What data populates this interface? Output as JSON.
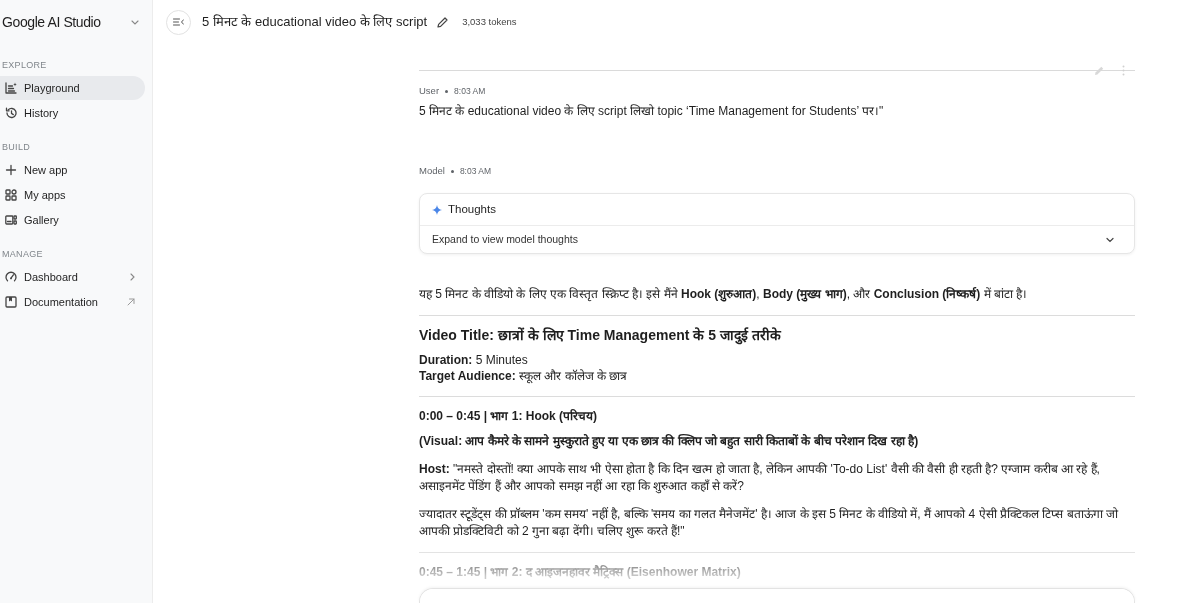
{
  "sidebar": {
    "title": "Google AI Studio",
    "sections": [
      {
        "heading": "EXPLORE",
        "items": [
          {
            "label": "Playground",
            "kind": "page",
            "selected": true
          },
          {
            "label": "History",
            "kind": "page",
            "selected": false
          }
        ]
      },
      {
        "heading": "BUILD",
        "items": [
          {
            "label": "New app",
            "kind": "page",
            "selected": false
          },
          {
            "label": "My apps",
            "kind": "page",
            "selected": false
          },
          {
            "label": "Gallery",
            "kind": "page",
            "selected": false
          }
        ]
      },
      {
        "heading": "MANAGE",
        "items": [
          {
            "label": "Dashboard",
            "kind": "menu",
            "selected": false
          },
          {
            "label": "Documentation",
            "kind": "external",
            "selected": false
          }
        ]
      }
    ]
  },
  "header": {
    "title": "5 मिनट के educational video के लिए script",
    "tokens": "3,033 tokens"
  },
  "chat": {
    "turns": [
      {
        "role": "User",
        "time": "8:03 AM",
        "blocks": [
          {
            "kind": "paragraph",
            "text": "5 मिनट के educational video के लिए script लिखो topic ‘Time Management for Students’ पर।\""
          }
        ]
      },
      {
        "role": "Model",
        "time": "8:03 AM",
        "thoughts": {
          "title": "Thoughts",
          "hint": "Expand to view model thoughts",
          "expanded": false
        },
        "blocks": [
          {
            "kind": "paragraph",
            "text": "यह 5 मिनट के वीडियो के लिए एक विस्तृत स्क्रिप्ट है। इसे मैंने **Hook (शुरुआत)**, **Body (मुख्य भाग)**, और **Conclusion (निष्कर्ष)** में बांटा है।"
          },
          {
            "kind": "divider"
          },
          {
            "kind": "title",
            "text": "Video Title: छात्रों के लिए Time Management के 5 जादुई तरीके"
          },
          {
            "kind": "line",
            "text": "**Duration:** 5 Minutes"
          },
          {
            "kind": "line",
            "text": "**Target Audience:** स्कूल और कॉलेज के छात्र"
          },
          {
            "kind": "divider"
          },
          {
            "kind": "section",
            "text": "0:00 – 0:45 | भाग 1: Hook (परिचय)"
          },
          {
            "kind": "note",
            "text": "(Visual: आप कैमरे के सामने मुस्कुराते हुए या एक छात्र की क्लिप जो बहुत सारी किताबों के बीच परेशान दिख रहा है)"
          },
          {
            "kind": "paragraph",
            "text": "**Host:** \"नमस्ते दोस्तों! क्या आपके साथ भी ऐसा होता है कि दिन खत्म हो जाता है, लेकिन आपकी 'To-do List' वैसी की वैसी ही रहती है? एग्जाम करीब आ रहे हैं, असाइनमेंट पेंडिंग हैं और आपको समझ नहीं आ रहा कि शुरुआत कहाँ से करें?"
          },
          {
            "kind": "paragraph",
            "text": "ज्यादातर स्टूडेंट्स की प्रॉब्लम 'कम समय' नहीं है, बल्कि 'समय का गलत मैनेजमेंट' है। आज के इस 5 मिनट के वीडियो में, मैं आपको 4 ऐसी प्रैक्टिकल टिप्स बताऊंगा जो आपकी प्रोडक्टिविटी को 2 गुना बढ़ा देंगी। चलिए शुरू करते हैं!\""
          },
          {
            "kind": "divider"
          },
          {
            "kind": "section",
            "text": "0:45 – 1:45 | भाग 2: द आइजनहावर मैट्रिक्स (Eisenhower Matrix)"
          }
        ]
      }
    ]
  }
}
